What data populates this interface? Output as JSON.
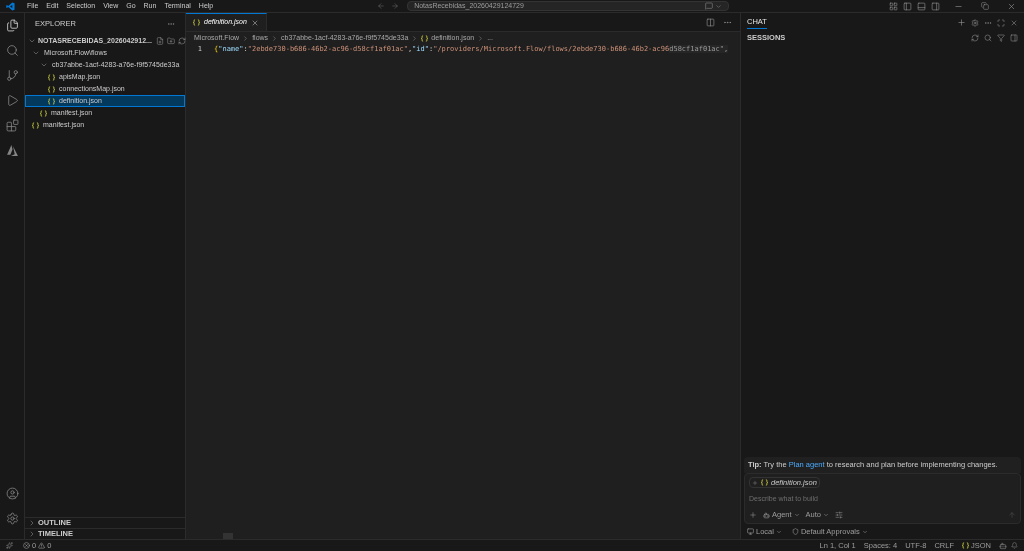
{
  "menu": [
    "File",
    "Edit",
    "Selection",
    "View",
    "Go",
    "Run",
    "Terminal",
    "Help"
  ],
  "command_center": {
    "label": "NotasRecebidas_20260429124729"
  },
  "explorer": {
    "title": "EXPLORER",
    "root": {
      "label": "NOTASRECEBIDAS_2026042912...",
      "expanded": true
    },
    "tree": [
      {
        "label": "Microsoft.Flow\\flows",
        "kind": "folder",
        "expanded": true,
        "selected": false,
        "children": [
          {
            "label": "cb37abbe-1acf-4283-a76e-f9f5745de33a",
            "kind": "folder",
            "expanded": true,
            "selected": false,
            "children": [
              {
                "label": "apisMap.json",
                "kind": "json",
                "selected": false
              },
              {
                "label": "connectionsMap.json",
                "kind": "json",
                "selected": false
              },
              {
                "label": "definition.json",
                "kind": "json",
                "selected": true
              }
            ]
          },
          {
            "label": "manifest.json",
            "kind": "json",
            "selected": false
          }
        ]
      },
      {
        "label": "manifest.json",
        "kind": "json",
        "selected": false
      }
    ],
    "panels": [
      {
        "label": "OUTLINE",
        "expanded": false
      },
      {
        "label": "TIMELINE",
        "expanded": false
      }
    ]
  },
  "tabs": [
    {
      "label": "definition.json",
      "selected": true
    }
  ],
  "breadcrumbs": [
    "Microsoft.Flow",
    "flows",
    "cb37abbe-1acf-4283-a76e-f9f5745de33a",
    "definition.json",
    "..."
  ],
  "code": [
    {
      "number": "1",
      "tokens": [
        {
          "kind": "brace",
          "text": "{"
        },
        {
          "kind": "key",
          "text": "\"name\""
        },
        {
          "kind": "punct",
          "text": ":"
        },
        {
          "kind": "string",
          "text": "\"2ebde730-b686-46b2-ac96-d58cf1af01ac\""
        },
        {
          "kind": "punct",
          "text": ","
        },
        {
          "kind": "key",
          "text": "\"id\""
        },
        {
          "kind": "punct",
          "text": ":"
        },
        {
          "kind": "string",
          "text": "\"/providers/Microsoft.Flow/flows/2ebde730-b686-46b2-ac96"
        },
        {
          "kind": "faded",
          "text": "d58cf1af01ac\","
        }
      ]
    }
  ],
  "chat": {
    "tab": "CHAT",
    "sessions": "SESSIONS",
    "tip": {
      "label": "Tip:",
      "before": "Try the",
      "link": "Plan agent",
      "after": "to research and plan before implementing changes."
    },
    "attachment": "definition.json",
    "placeholder": "Describe what to build",
    "mode": "Agent",
    "model": "Auto",
    "location": "Local",
    "approvals": "Default Approvals"
  },
  "status": {
    "errors": "0",
    "warnings": "0",
    "items": [
      "Ln 1, Col 1",
      "Spaces: 4",
      "UTF-8",
      "CRLF"
    ],
    "language": "JSON"
  }
}
